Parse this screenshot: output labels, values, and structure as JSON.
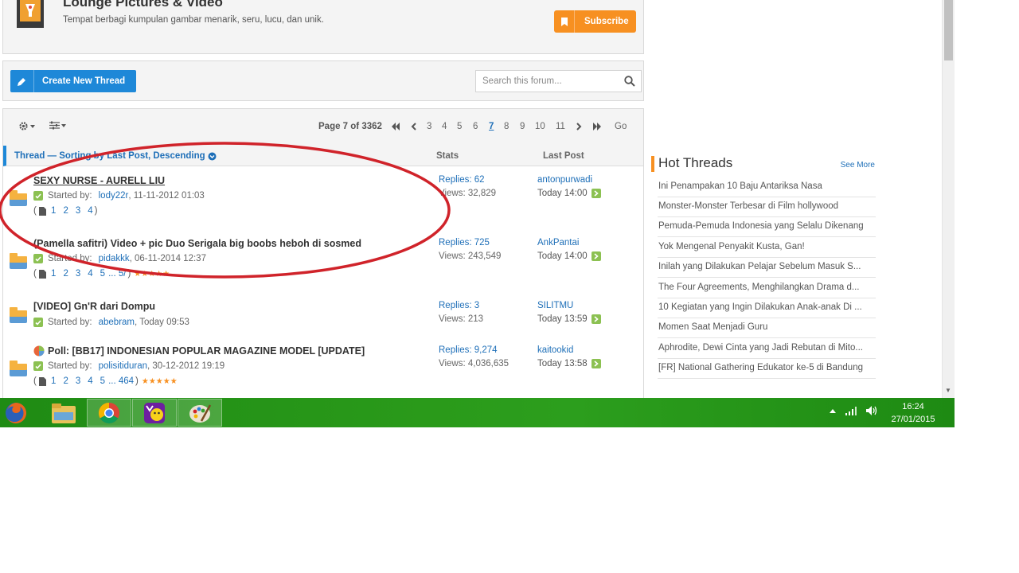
{
  "forum": {
    "title": "Lounge Pictures & Video",
    "description": "Tempat berbagi kumpulan gambar menarik, seru, lucu, dan unik.",
    "subscribe_label": "Subscribe"
  },
  "toolbar": {
    "create_label": "Create New Thread",
    "search_placeholder": "Search this forum..."
  },
  "pagination": {
    "label": "Page 7 of 3362",
    "pages": [
      "3",
      "4",
      "5",
      "6",
      "7",
      "8",
      "9",
      "10",
      "11"
    ],
    "current": "7",
    "go_label": "Go"
  },
  "columns": {
    "thread": "Thread — Sorting by Last Post, Descending",
    "stats": "Stats",
    "last_post": "Last Post"
  },
  "threads": [
    {
      "title": "SEXY NURSE - AURELL LIU",
      "started_by_label": "Started by:",
      "author": "lody22r",
      "date": ", 11-11-2012 01:03",
      "pages": [
        "1",
        "2",
        "3",
        "4"
      ],
      "replies": "Replies: 62",
      "views": "Views: 32,829",
      "last_user": "antonpurwadi",
      "last_time": "Today 14:00"
    },
    {
      "title": "(Pamella safitri) Video + pic Duo Serigala big boobs heboh di sosmed",
      "started_by_label": "Started by:",
      "author": "pidakkk",
      "date": ", 06-11-2014 12:37",
      "pages": [
        "1",
        "2",
        "3",
        "4",
        "5"
      ],
      "pages_more": "... 5/",
      "replies": "Replies: 725",
      "views": "Views: 243,549",
      "last_user": "AnkPantai",
      "last_time": "Today 14:00"
    },
    {
      "title": "[VIDEO] Gn'R dari Dompu",
      "started_by_label": "Started by:",
      "author": "abebram",
      "date": ", Today 09:53",
      "replies": "Replies: 3",
      "views": "Views: 213",
      "last_user": "SILITMU",
      "last_time": "Today 13:59"
    },
    {
      "title": "Poll: [BB17] INDONESIAN POPULAR MAGAZINE MODEL [UPDATE]",
      "started_by_label": "Started by:",
      "author": "polisitiduran",
      "date": ", 30-12-2012 19:19",
      "pages": [
        "1",
        "2",
        "3",
        "4",
        "5"
      ],
      "pages_more": "... 464",
      "replies": "Replies: 9,274",
      "views": "Views: 4,036,635",
      "last_user": "kaitookid",
      "last_time": "Today 13:58"
    }
  ],
  "hot_threads": {
    "title": "Hot Threads",
    "see_more": "See More",
    "items": [
      "Ini Penampakan 10 Baju Antariksa Nasa",
      "Monster-Monster Terbesar di Film hollywood",
      "Pemuda-Pemuda Indonesia yang Selalu Dikenang",
      "Yok Mengenal Penyakit Kusta, Gan!",
      "Inilah yang Dilakukan Pelajar Sebelum Masuk S...",
      "The Four Agreements, Menghilangkan Drama d...",
      "10 Kegiatan yang Ingin Dilakukan Anak-anak Di ...",
      "Momen Saat Menjadi Guru",
      "Aphrodite, Dewi Cinta yang Jadi Rebutan di Mito...",
      "[FR] National Gathering Edukator ke-5 di Bandung"
    ]
  },
  "taskbar": {
    "time": "16:24",
    "date": "27/01/2015"
  },
  "colors": {
    "accent_blue": "#1e88d8",
    "subscribe_orange": "#f79021",
    "taskbar_green": "#2a9a1a",
    "annotation_red": "#d0232a"
  }
}
